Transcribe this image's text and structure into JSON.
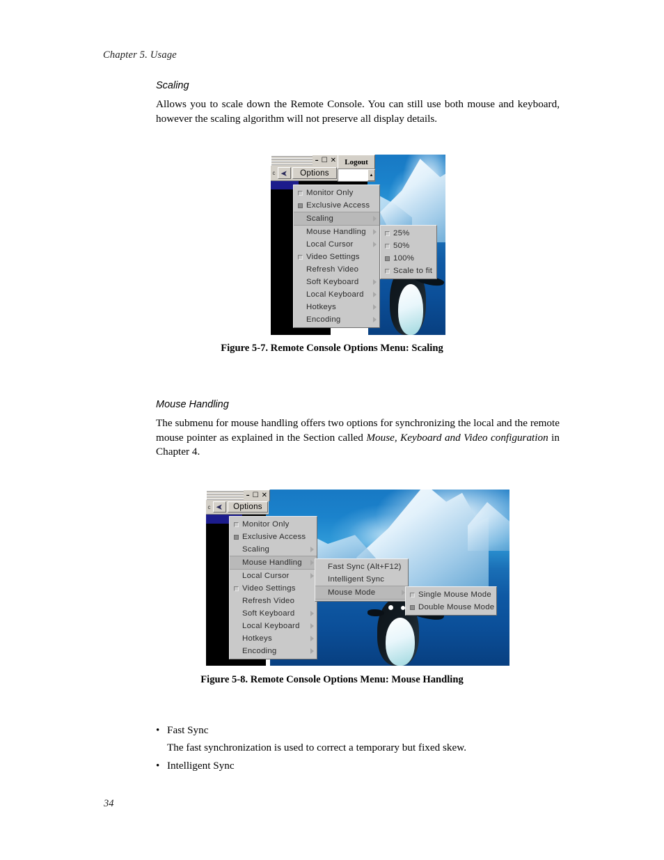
{
  "document": {
    "chapter_header": "Chapter 5. Usage",
    "page_number": "34",
    "sections": [
      {
        "title": "Scaling",
        "paragraph": "Allows you to scale down the Remote Console. You can still use both mouse and keyboard, however the scaling algorithm will not preserve all display details."
      },
      {
        "title": "Mouse Handling",
        "paragraph_part1": "The submenu for mouse handling offers two options for synchronizing the local and the remote mouse pointer as explained in the Section called ",
        "paragraph_italic": "Mouse, Keyboard and Video configuration",
        "paragraph_part2": " in Chapter 4."
      }
    ],
    "figure_captions": {
      "fig57": "Figure 5-7. Remote Console Options Menu: Scaling",
      "fig58": "Figure 5-8. Remote Console Options Menu: Mouse Handling"
    },
    "bullets": [
      {
        "marker": "•",
        "label": "Fast Sync"
      },
      {
        "marker": "",
        "label": "The fast synchronization is used to correct a temporary but fixed skew."
      },
      {
        "marker": "•",
        "label": "Intelligent Sync"
      }
    ]
  },
  "figure57": {
    "window": {
      "minimize_label": "–",
      "maximize_label": "☐",
      "close_label": "✕",
      "logout_label": "Logout",
      "toolbar_edge_label": "c",
      "options_label": "Options",
      "scroll_up_label": "▲"
    },
    "options_menu": [
      {
        "label": "Monitor Only",
        "check": "off",
        "submenu": false,
        "highlighted": false
      },
      {
        "label": "Exclusive Access",
        "check": "on",
        "submenu": false,
        "highlighted": false
      },
      {
        "label": "Scaling",
        "check": "none",
        "submenu": true,
        "highlighted": true
      },
      {
        "label": "Mouse Handling",
        "check": "none",
        "submenu": true,
        "highlighted": false
      },
      {
        "label": "Local Cursor",
        "check": "none",
        "submenu": true,
        "highlighted": false
      },
      {
        "label": "Video Settings",
        "check": "off",
        "submenu": false,
        "highlighted": false
      },
      {
        "label": "Refresh Video",
        "check": "none",
        "submenu": false,
        "highlighted": false
      },
      {
        "label": "Soft Keyboard",
        "check": "none",
        "submenu": true,
        "highlighted": false
      },
      {
        "label": "Local Keyboard",
        "check": "none",
        "submenu": true,
        "highlighted": false
      },
      {
        "label": "Hotkeys",
        "check": "none",
        "submenu": true,
        "highlighted": false
      },
      {
        "label": "Encoding",
        "check": "none",
        "submenu": true,
        "highlighted": false
      }
    ],
    "scaling_submenu": [
      {
        "label": "25%",
        "check": "off"
      },
      {
        "label": "50%",
        "check": "off"
      },
      {
        "label": "100%",
        "check": "on"
      },
      {
        "label": "Scale to fit",
        "check": "off"
      }
    ]
  },
  "figure58": {
    "window": {
      "minimize_label": "–",
      "maximize_label": "☐",
      "close_label": "✕",
      "toolbar_edge_label": "c",
      "options_label": "Options"
    },
    "options_menu": [
      {
        "label": "Monitor Only",
        "check": "off",
        "submenu": false,
        "highlighted": false
      },
      {
        "label": "Exclusive Access",
        "check": "on",
        "submenu": false,
        "highlighted": false
      },
      {
        "label": "Scaling",
        "check": "none",
        "submenu": true,
        "highlighted": false
      },
      {
        "label": "Mouse Handling",
        "check": "none",
        "submenu": true,
        "highlighted": true
      },
      {
        "label": "Local Cursor",
        "check": "none",
        "submenu": true,
        "highlighted": false
      },
      {
        "label": "Video Settings",
        "check": "off",
        "submenu": false,
        "highlighted": false
      },
      {
        "label": "Refresh Video",
        "check": "none",
        "submenu": false,
        "highlighted": false
      },
      {
        "label": "Soft Keyboard",
        "check": "none",
        "submenu": true,
        "highlighted": false
      },
      {
        "label": "Local Keyboard",
        "check": "none",
        "submenu": true,
        "highlighted": false
      },
      {
        "label": "Hotkeys",
        "check": "none",
        "submenu": true,
        "highlighted": false
      },
      {
        "label": "Encoding",
        "check": "none",
        "submenu": true,
        "highlighted": false
      }
    ],
    "mouse_handling_submenu": [
      {
        "label": "Fast Sync (Alt+F12)",
        "check": "none",
        "submenu": false,
        "highlighted": false
      },
      {
        "label": "Intelligent Sync",
        "check": "none",
        "submenu": false,
        "highlighted": false
      },
      {
        "label": "Mouse Mode",
        "check": "none",
        "submenu": true,
        "highlighted": true
      }
    ],
    "mouse_mode_submenu": [
      {
        "label": "Single Mouse Mode",
        "check": "off"
      },
      {
        "label": "Double Mouse Mode",
        "check": "on"
      }
    ]
  },
  "colors": {
    "menu_bg": "#c9c9c9",
    "chrome_bg": "#d4d0c8",
    "highlight": "#b9b9b9",
    "selection_blue": "#1c1c8c",
    "photo_blue": "#1879c4"
  }
}
